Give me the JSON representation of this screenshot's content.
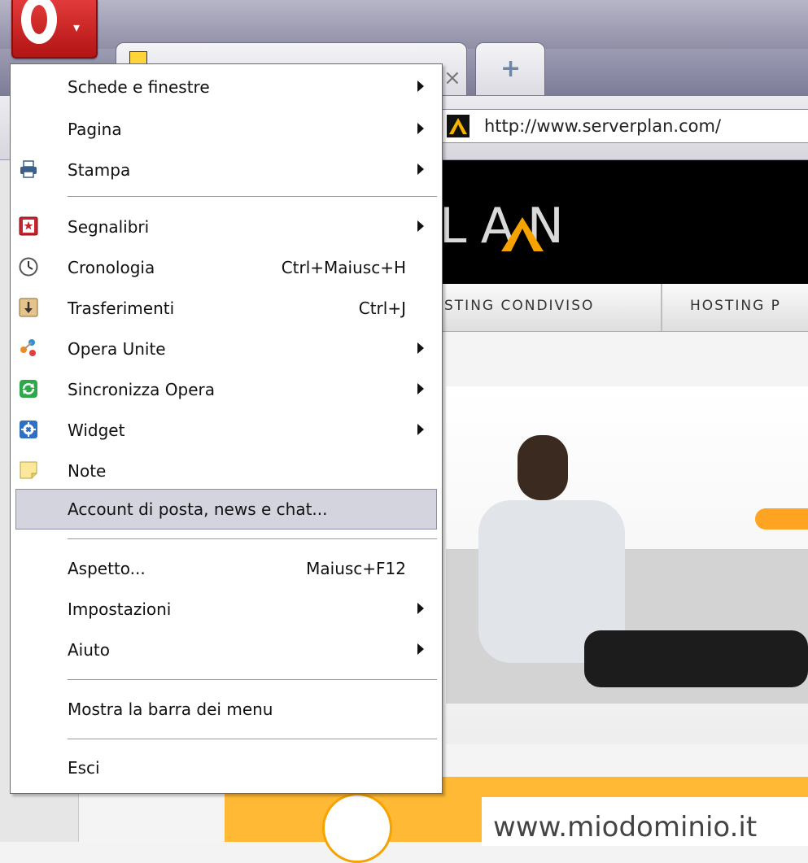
{
  "browser": {
    "tab_title": "",
    "address_url": "http://www.serverplan.com/"
  },
  "page": {
    "logo_text": "LAN",
    "nav_items": [
      "STING CONDIVISO",
      "HOSTING P"
    ],
    "domain_text": "www.miodominio.it"
  },
  "menu": {
    "items": [
      {
        "label": "Schede e finestre",
        "shortcut": "",
        "submenu": true,
        "icon": ""
      },
      {
        "label": "Pagina",
        "shortcut": "",
        "submenu": true,
        "icon": ""
      },
      {
        "label": "Stampa",
        "shortcut": "",
        "submenu": true,
        "icon": "printer-icon"
      },
      {
        "label": "Segnalibri",
        "shortcut": "",
        "submenu": true,
        "icon": "bookmarks-icon"
      },
      {
        "label": "Cronologia",
        "shortcut": "Ctrl+Maiusc+H",
        "submenu": false,
        "icon": "history-clock-icon"
      },
      {
        "label": "Trasferimenti",
        "shortcut": "Ctrl+J",
        "submenu": false,
        "icon": "downloads-icon"
      },
      {
        "label": "Opera Unite",
        "shortcut": "",
        "submenu": true,
        "icon": "opera-unite-icon"
      },
      {
        "label": "Sincronizza Opera",
        "shortcut": "",
        "submenu": true,
        "icon": "sync-icon"
      },
      {
        "label": "Widget",
        "shortcut": "",
        "submenu": true,
        "icon": "widget-gear-icon"
      },
      {
        "label": "Note",
        "shortcut": "",
        "submenu": false,
        "icon": "notes-icon"
      },
      {
        "label": "Account di posta, news e chat...",
        "shortcut": "",
        "submenu": false,
        "icon": "",
        "highlighted": true
      },
      {
        "label": "Aspetto...",
        "shortcut": "Maiusc+F12",
        "submenu": false,
        "icon": ""
      },
      {
        "label": "Impostazioni",
        "shortcut": "",
        "submenu": true,
        "icon": ""
      },
      {
        "label": "Aiuto",
        "shortcut": "",
        "submenu": true,
        "icon": ""
      },
      {
        "label": "Mostra la barra dei menu",
        "shortcut": "",
        "submenu": false,
        "icon": ""
      },
      {
        "label": "Esci",
        "shortcut": "",
        "submenu": false,
        "icon": ""
      }
    ]
  },
  "colors": {
    "opera_red": "#c8102e",
    "menu_highlight": "#d4d4df",
    "brand_orange": "#ffa422"
  }
}
